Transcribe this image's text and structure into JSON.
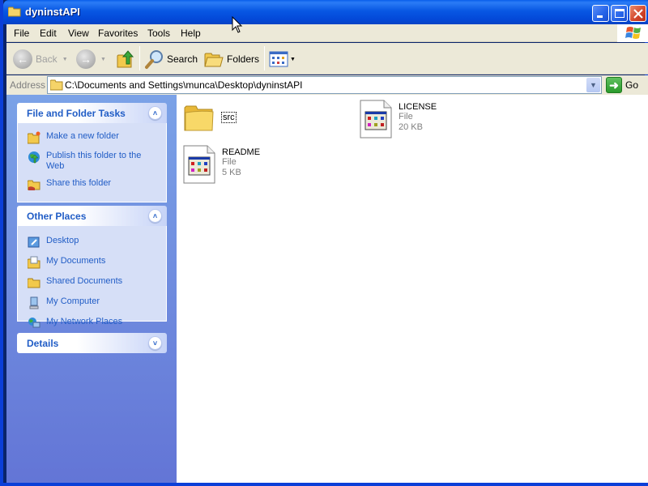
{
  "window": {
    "title": "dyninstAPI",
    "caption_buttons": {
      "minimize": "minimize-icon",
      "maximize": "maximize-icon",
      "close": "close-icon"
    }
  },
  "menubar": {
    "items": [
      "File",
      "Edit",
      "View",
      "Favorites",
      "Tools",
      "Help"
    ]
  },
  "toolbar": {
    "back_label": "Back",
    "search_label": "Search",
    "folders_label": "Folders"
  },
  "address": {
    "label": "Address",
    "value": "C:\\Documents and Settings\\munca\\Desktop\\dyninstAPI",
    "go_label": "Go"
  },
  "sidebar": {
    "panels": [
      {
        "title": "File and Folder Tasks",
        "items": [
          {
            "label": "Make a new folder",
            "icon": "new-folder-icon"
          },
          {
            "label": "Publish this folder to the Web",
            "icon": "publish-web-icon"
          },
          {
            "label": "Share this folder",
            "icon": "share-folder-icon"
          }
        ]
      },
      {
        "title": "Other Places",
        "items": [
          {
            "label": "Desktop",
            "icon": "desktop-icon"
          },
          {
            "label": "My Documents",
            "icon": "my-documents-icon"
          },
          {
            "label": "Shared Documents",
            "icon": "shared-documents-icon"
          },
          {
            "label": "My Computer",
            "icon": "my-computer-icon"
          },
          {
            "label": "My Network Places",
            "icon": "network-places-icon"
          }
        ]
      },
      {
        "title": "Details",
        "items": []
      }
    ]
  },
  "files": [
    {
      "name": "src",
      "type": "folder"
    },
    {
      "name": "LICENSE",
      "type": "File",
      "size": "20 KB"
    },
    {
      "name": "README",
      "type": "File",
      "size": "5 KB"
    }
  ],
  "colors": {
    "titlebar": "#0857e3",
    "sidebar": "#6d8ee0",
    "link": "#215dc6",
    "chrome": "#ece9d8"
  }
}
